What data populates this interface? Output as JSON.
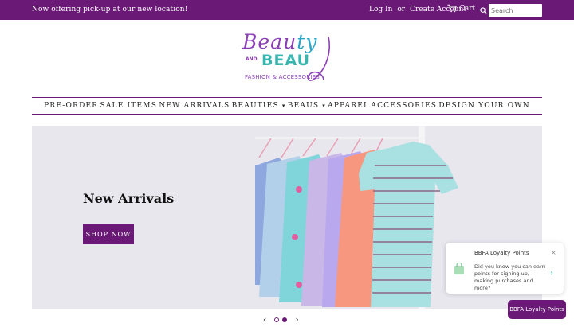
{
  "announcement": {
    "text": "Now offering pick-up at our new location!"
  },
  "account": {
    "login": "Log In",
    "or": "or",
    "create": "Create Account"
  },
  "cart": {
    "label": "Cart",
    "icon": "cart-icon"
  },
  "search": {
    "placeholder": "Search",
    "icon": "search-icon"
  },
  "logo": {
    "line1a": "Beau",
    "line1b": "ty",
    "and": "AND",
    "line2": "BEAU",
    "tagline": "FASHION & ACCESSORIES"
  },
  "nav": {
    "items": [
      {
        "label": "PRE-ORDER"
      },
      {
        "label": "SALE ITEMS"
      },
      {
        "label": "NEW ARRIVALS"
      },
      {
        "label": "BEAUTIES",
        "dropdown": "▾"
      },
      {
        "label": "BEAUS",
        "dropdown": "▾"
      },
      {
        "label": "APPAREL"
      },
      {
        "label": "ACCESSORIES"
      },
      {
        "label": "DESIGN YOUR OWN"
      }
    ]
  },
  "hero": {
    "title": "New Arrivals",
    "button": "SHOP NOW"
  },
  "slider": {
    "prev": "‹",
    "next": "›"
  },
  "loyalty_popup": {
    "title": "BBFA Loyalty Points",
    "close": "×",
    "body": "Did you know you can earn points for signing up, making purchases and more?",
    "arrow": "›"
  },
  "loyalty_button": {
    "label": "BBFA Loyalty Points"
  },
  "colors": {
    "brand": "#6a1a76",
    "teal": "#39b5b0",
    "purple": "#8a3fb5"
  }
}
